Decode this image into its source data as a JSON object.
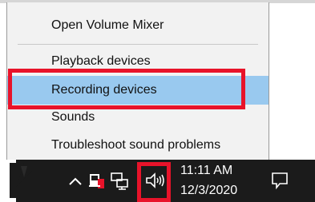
{
  "context_menu": {
    "items": [
      {
        "label": "Open Volume Mixer"
      },
      {
        "label": "Playback devices"
      },
      {
        "label": "Recording devices"
      },
      {
        "label": "Sounds"
      },
      {
        "label": "Troubleshoot sound problems"
      }
    ]
  },
  "taskbar": {
    "clock": {
      "time": "11:11 AM",
      "date": "12/3/2020"
    },
    "icons": [
      "chevron-up-icon",
      "security-icon",
      "network-icon",
      "speaker-icon",
      "notification-icon"
    ]
  },
  "colors": {
    "highlight": "#99c9ef",
    "annotation_red": "#e8132a",
    "taskbar": "#1b1b1b",
    "menu_bg": "#f2f2f2"
  }
}
